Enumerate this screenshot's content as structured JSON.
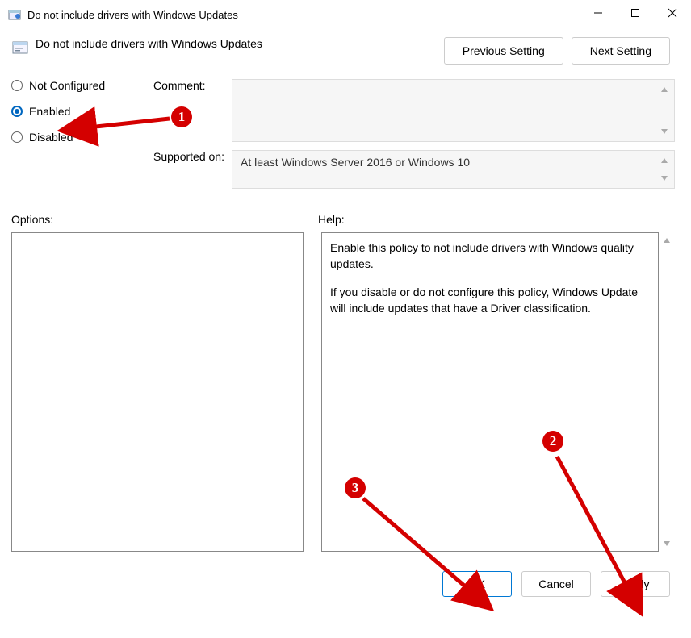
{
  "window": {
    "title": "Do not include drivers with Windows Updates"
  },
  "header": {
    "policy_title": "Do not include drivers with Windows Updates",
    "previous": "Previous Setting",
    "next": "Next Setting"
  },
  "radios": {
    "not_configured": "Not Configured",
    "enabled": "Enabled",
    "disabled": "Disabled",
    "selected": "enabled"
  },
  "fields": {
    "comment_label": "Comment:",
    "comment_value": "",
    "supported_label": "Supported on:",
    "supported_value": "At least Windows Server 2016 or Windows 10"
  },
  "panes": {
    "options_label": "Options:",
    "help_label": "Help:",
    "help_text_1": "Enable this policy to not include drivers with Windows quality updates.",
    "help_text_2": "If you disable or do not configure this policy, Windows Update will include updates that have a Driver classification."
  },
  "footer": {
    "ok": "OK",
    "cancel": "Cancel",
    "apply": "Apply"
  },
  "annotations": {
    "b1": "1",
    "b2": "2",
    "b3": "3"
  }
}
